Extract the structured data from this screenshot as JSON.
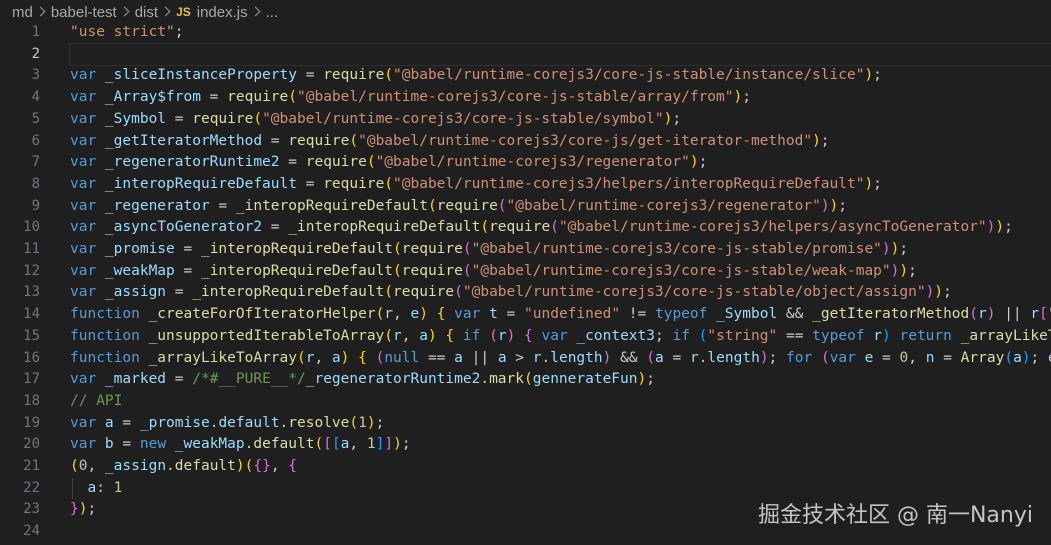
{
  "breadcrumb": {
    "items": [
      "md",
      "babel-test",
      "dist"
    ],
    "file_icon": "JS",
    "file_name": "index.js",
    "more": "..."
  },
  "editor": {
    "current_line": 2,
    "lines": [
      {
        "n": "1",
        "tokens": [
          [
            "str",
            "\"use strict\""
          ],
          [
            "txt",
            ";"
          ]
        ]
      },
      {
        "n": "2",
        "tokens": []
      },
      {
        "n": "3",
        "tokens": [
          [
            "kw",
            "var "
          ],
          [
            "var",
            "_sliceInstanceProperty"
          ],
          [
            "txt",
            " = "
          ],
          [
            "fn",
            "require"
          ],
          [
            "p1",
            "("
          ],
          [
            "str",
            "\"@babel/runtime-corejs3/core-js-stable/instance/slice\""
          ],
          [
            "p1",
            ")"
          ],
          [
            "txt",
            ";"
          ]
        ]
      },
      {
        "n": "4",
        "tokens": [
          [
            "kw",
            "var "
          ],
          [
            "var",
            "_Array$from"
          ],
          [
            "txt",
            " = "
          ],
          [
            "fn",
            "require"
          ],
          [
            "p1",
            "("
          ],
          [
            "str",
            "\"@babel/runtime-corejs3/core-js-stable/array/from\""
          ],
          [
            "p1",
            ")"
          ],
          [
            "txt",
            ";"
          ]
        ]
      },
      {
        "n": "5",
        "tokens": [
          [
            "kw",
            "var "
          ],
          [
            "var",
            "_Symbol"
          ],
          [
            "txt",
            " = "
          ],
          [
            "fn",
            "require"
          ],
          [
            "p1",
            "("
          ],
          [
            "str",
            "\"@babel/runtime-corejs3/core-js-stable/symbol\""
          ],
          [
            "p1",
            ")"
          ],
          [
            "txt",
            ";"
          ]
        ]
      },
      {
        "n": "6",
        "tokens": [
          [
            "kw",
            "var "
          ],
          [
            "var",
            "_getIteratorMethod"
          ],
          [
            "txt",
            " = "
          ],
          [
            "fn",
            "require"
          ],
          [
            "p1",
            "("
          ],
          [
            "str",
            "\"@babel/runtime-corejs3/core-js/get-iterator-method\""
          ],
          [
            "p1",
            ")"
          ],
          [
            "txt",
            ";"
          ]
        ]
      },
      {
        "n": "7",
        "tokens": [
          [
            "kw",
            "var "
          ],
          [
            "var",
            "_regeneratorRuntime2"
          ],
          [
            "txt",
            " = "
          ],
          [
            "fn",
            "require"
          ],
          [
            "p1",
            "("
          ],
          [
            "str",
            "\"@babel/runtime-corejs3/regenerator\""
          ],
          [
            "p1",
            ")"
          ],
          [
            "txt",
            ";"
          ]
        ]
      },
      {
        "n": "8",
        "tokens": [
          [
            "kw",
            "var "
          ],
          [
            "var",
            "_interopRequireDefault"
          ],
          [
            "txt",
            " = "
          ],
          [
            "fn",
            "require"
          ],
          [
            "p1",
            "("
          ],
          [
            "str",
            "\"@babel/runtime-corejs3/helpers/interopRequireDefault\""
          ],
          [
            "p1",
            ")"
          ],
          [
            "txt",
            ";"
          ]
        ]
      },
      {
        "n": "9",
        "tokens": [
          [
            "kw",
            "var "
          ],
          [
            "var",
            "_regenerator"
          ],
          [
            "txt",
            " = "
          ],
          [
            "fn",
            "_interopRequireDefault"
          ],
          [
            "p1",
            "("
          ],
          [
            "fn",
            "require"
          ],
          [
            "p2",
            "("
          ],
          [
            "str",
            "\"@babel/runtime-corejs3/regenerator\""
          ],
          [
            "p2",
            ")"
          ],
          [
            "p1",
            ")"
          ],
          [
            "txt",
            ";"
          ]
        ]
      },
      {
        "n": "10",
        "tokens": [
          [
            "kw",
            "var "
          ],
          [
            "var",
            "_asyncToGenerator2"
          ],
          [
            "txt",
            " = "
          ],
          [
            "fn",
            "_interopRequireDefault"
          ],
          [
            "p1",
            "("
          ],
          [
            "fn",
            "require"
          ],
          [
            "p2",
            "("
          ],
          [
            "str",
            "\"@babel/runtime-corejs3/helpers/asyncToGenerator\""
          ],
          [
            "p2",
            ")"
          ],
          [
            "p1",
            ")"
          ],
          [
            "txt",
            ";"
          ]
        ]
      },
      {
        "n": "11",
        "tokens": [
          [
            "kw",
            "var "
          ],
          [
            "var",
            "_promise"
          ],
          [
            "txt",
            " = "
          ],
          [
            "fn",
            "_interopRequireDefault"
          ],
          [
            "p1",
            "("
          ],
          [
            "fn",
            "require"
          ],
          [
            "p2",
            "("
          ],
          [
            "str",
            "\"@babel/runtime-corejs3/core-js-stable/promise\""
          ],
          [
            "p2",
            ")"
          ],
          [
            "p1",
            ")"
          ],
          [
            "txt",
            ";"
          ]
        ]
      },
      {
        "n": "12",
        "tokens": [
          [
            "kw",
            "var "
          ],
          [
            "var",
            "_weakMap"
          ],
          [
            "txt",
            " = "
          ],
          [
            "fn",
            "_interopRequireDefault"
          ],
          [
            "p1",
            "("
          ],
          [
            "fn",
            "require"
          ],
          [
            "p2",
            "("
          ],
          [
            "str",
            "\"@babel/runtime-corejs3/core-js-stable/weak-map\""
          ],
          [
            "p2",
            ")"
          ],
          [
            "p1",
            ")"
          ],
          [
            "txt",
            ";"
          ]
        ]
      },
      {
        "n": "13",
        "tokens": [
          [
            "kw",
            "var "
          ],
          [
            "var",
            "_assign"
          ],
          [
            "txt",
            " = "
          ],
          [
            "fn",
            "_interopRequireDefault"
          ],
          [
            "p1",
            "("
          ],
          [
            "fn",
            "require"
          ],
          [
            "p2",
            "("
          ],
          [
            "str",
            "\"@babel/runtime-corejs3/core-js-stable/object/assign\""
          ],
          [
            "p2",
            ")"
          ],
          [
            "p1",
            ")"
          ],
          [
            "txt",
            ";"
          ]
        ]
      },
      {
        "n": "14",
        "tokens": [
          [
            "kw",
            "function "
          ],
          [
            "fn",
            "_createForOfIteratorHelper"
          ],
          [
            "p1",
            "("
          ],
          [
            "var",
            "r"
          ],
          [
            "txt",
            ", "
          ],
          [
            "var",
            "e"
          ],
          [
            "p1",
            ")"
          ],
          [
            "txt",
            " "
          ],
          [
            "p1",
            "{"
          ],
          [
            "txt",
            " "
          ],
          [
            "kw",
            "var "
          ],
          [
            "var",
            "t"
          ],
          [
            "txt",
            " = "
          ],
          [
            "str",
            "\"undefined\""
          ],
          [
            "txt",
            " != "
          ],
          [
            "kw",
            "typeof "
          ],
          [
            "var",
            "_Symbol"
          ],
          [
            "txt",
            " && "
          ],
          [
            "fn",
            "_getIteratorMethod"
          ],
          [
            "p2",
            "("
          ],
          [
            "var",
            "r"
          ],
          [
            "p2",
            ")"
          ],
          [
            "txt",
            " || "
          ],
          [
            "var",
            "r"
          ],
          [
            "p2",
            "["
          ],
          [
            "str",
            "\""
          ]
        ]
      },
      {
        "n": "15",
        "tokens": [
          [
            "kw",
            "function "
          ],
          [
            "fn",
            "_unsupportedIterableToArray"
          ],
          [
            "p1",
            "("
          ],
          [
            "var",
            "r"
          ],
          [
            "txt",
            ", "
          ],
          [
            "var",
            "a"
          ],
          [
            "p1",
            ")"
          ],
          [
            "txt",
            " "
          ],
          [
            "p1",
            "{"
          ],
          [
            "txt",
            " "
          ],
          [
            "kw",
            "if "
          ],
          [
            "p2",
            "("
          ],
          [
            "var",
            "r"
          ],
          [
            "p2",
            ")"
          ],
          [
            "txt",
            " "
          ],
          [
            "p2",
            "{"
          ],
          [
            "txt",
            " "
          ],
          [
            "kw",
            "var "
          ],
          [
            "var",
            "_context3"
          ],
          [
            "txt",
            "; "
          ],
          [
            "kw",
            "if "
          ],
          [
            "p3",
            "("
          ],
          [
            "str",
            "\"string\""
          ],
          [
            "txt",
            " == "
          ],
          [
            "kw",
            "typeof "
          ],
          [
            "var",
            "r"
          ],
          [
            "p3",
            ")"
          ],
          [
            "txt",
            " "
          ],
          [
            "kw",
            "return "
          ],
          [
            "fn",
            "_arrayLikeT"
          ]
        ]
      },
      {
        "n": "16",
        "tokens": [
          [
            "kw",
            "function "
          ],
          [
            "fn",
            "_arrayLikeToArray"
          ],
          [
            "p1",
            "("
          ],
          [
            "var",
            "r"
          ],
          [
            "txt",
            ", "
          ],
          [
            "var",
            "a"
          ],
          [
            "p1",
            ")"
          ],
          [
            "txt",
            " "
          ],
          [
            "p1",
            "{"
          ],
          [
            "txt",
            " "
          ],
          [
            "p2",
            "("
          ],
          [
            "kw",
            "null"
          ],
          [
            "txt",
            " == "
          ],
          [
            "var",
            "a"
          ],
          [
            "txt",
            " || "
          ],
          [
            "var",
            "a"
          ],
          [
            "txt",
            " > "
          ],
          [
            "var",
            "r"
          ],
          [
            "txt",
            "."
          ],
          [
            "var",
            "length"
          ],
          [
            "p2",
            ")"
          ],
          [
            "txt",
            " && "
          ],
          [
            "p2",
            "("
          ],
          [
            "var",
            "a"
          ],
          [
            "txt",
            " = "
          ],
          [
            "var",
            "r"
          ],
          [
            "txt",
            "."
          ],
          [
            "var",
            "length"
          ],
          [
            "p2",
            ")"
          ],
          [
            "txt",
            "; "
          ],
          [
            "kw",
            "for "
          ],
          [
            "p2",
            "("
          ],
          [
            "kw",
            "var "
          ],
          [
            "var",
            "e"
          ],
          [
            "txt",
            " = "
          ],
          [
            "num",
            "0"
          ],
          [
            "txt",
            ", "
          ],
          [
            "var",
            "n"
          ],
          [
            "txt",
            " = "
          ],
          [
            "fn",
            "Array"
          ],
          [
            "p3",
            "("
          ],
          [
            "var",
            "a"
          ],
          [
            "p3",
            ")"
          ],
          [
            "txt",
            "; "
          ],
          [
            "var",
            "e"
          ]
        ]
      },
      {
        "n": "17",
        "tokens": [
          [
            "kw",
            "var "
          ],
          [
            "var",
            "_marked"
          ],
          [
            "txt",
            " = "
          ],
          [
            "cmt",
            "/*#__PURE__*/"
          ],
          [
            "var",
            "_regeneratorRuntime2"
          ],
          [
            "txt",
            "."
          ],
          [
            "fn",
            "mark"
          ],
          [
            "p1",
            "("
          ],
          [
            "var",
            "gennerateFun"
          ],
          [
            "p1",
            ")"
          ],
          [
            "txt",
            ";"
          ]
        ]
      },
      {
        "n": "18",
        "tokens": [
          [
            "cmt",
            "// API"
          ]
        ]
      },
      {
        "n": "19",
        "tokens": [
          [
            "kw",
            "var "
          ],
          [
            "var",
            "a"
          ],
          [
            "txt",
            " = "
          ],
          [
            "var",
            "_promise"
          ],
          [
            "txt",
            "."
          ],
          [
            "var",
            "default"
          ],
          [
            "txt",
            "."
          ],
          [
            "fn",
            "resolve"
          ],
          [
            "p1",
            "("
          ],
          [
            "num",
            "1"
          ],
          [
            "p1",
            ")"
          ],
          [
            "txt",
            ";"
          ]
        ]
      },
      {
        "n": "20",
        "tokens": [
          [
            "kw",
            "var "
          ],
          [
            "var",
            "b"
          ],
          [
            "txt",
            " = "
          ],
          [
            "kw",
            "new "
          ],
          [
            "var",
            "_weakMap"
          ],
          [
            "txt",
            "."
          ],
          [
            "fn",
            "default"
          ],
          [
            "p1",
            "("
          ],
          [
            "p2",
            "["
          ],
          [
            "p3",
            "["
          ],
          [
            "var",
            "a"
          ],
          [
            "txt",
            ", "
          ],
          [
            "num",
            "1"
          ],
          [
            "p3",
            "]"
          ],
          [
            "p2",
            "]"
          ],
          [
            "p1",
            ")"
          ],
          [
            "txt",
            ";"
          ]
        ]
      },
      {
        "n": "21",
        "tokens": [
          [
            "p1",
            "("
          ],
          [
            "num",
            "0"
          ],
          [
            "txt",
            ", "
          ],
          [
            "var",
            "_assign"
          ],
          [
            "txt",
            "."
          ],
          [
            "fn",
            "default"
          ],
          [
            "p1",
            ")"
          ],
          [
            "p1",
            "("
          ],
          [
            "p2",
            "{}"
          ],
          [
            "txt",
            ", "
          ],
          [
            "p2",
            "{"
          ]
        ]
      },
      {
        "n": "22",
        "tokens": [
          [
            "txt",
            "  "
          ],
          [
            "var",
            "a"
          ],
          [
            "txt",
            ": "
          ],
          [
            "num",
            "1"
          ]
        ]
      },
      {
        "n": "23",
        "tokens": [
          [
            "p2",
            "}"
          ],
          [
            "p1",
            ")"
          ],
          [
            "txt",
            ";"
          ]
        ]
      },
      {
        "n": "24",
        "tokens": []
      }
    ]
  },
  "watermark": "掘金技术社区 @ 南一Nanyi"
}
